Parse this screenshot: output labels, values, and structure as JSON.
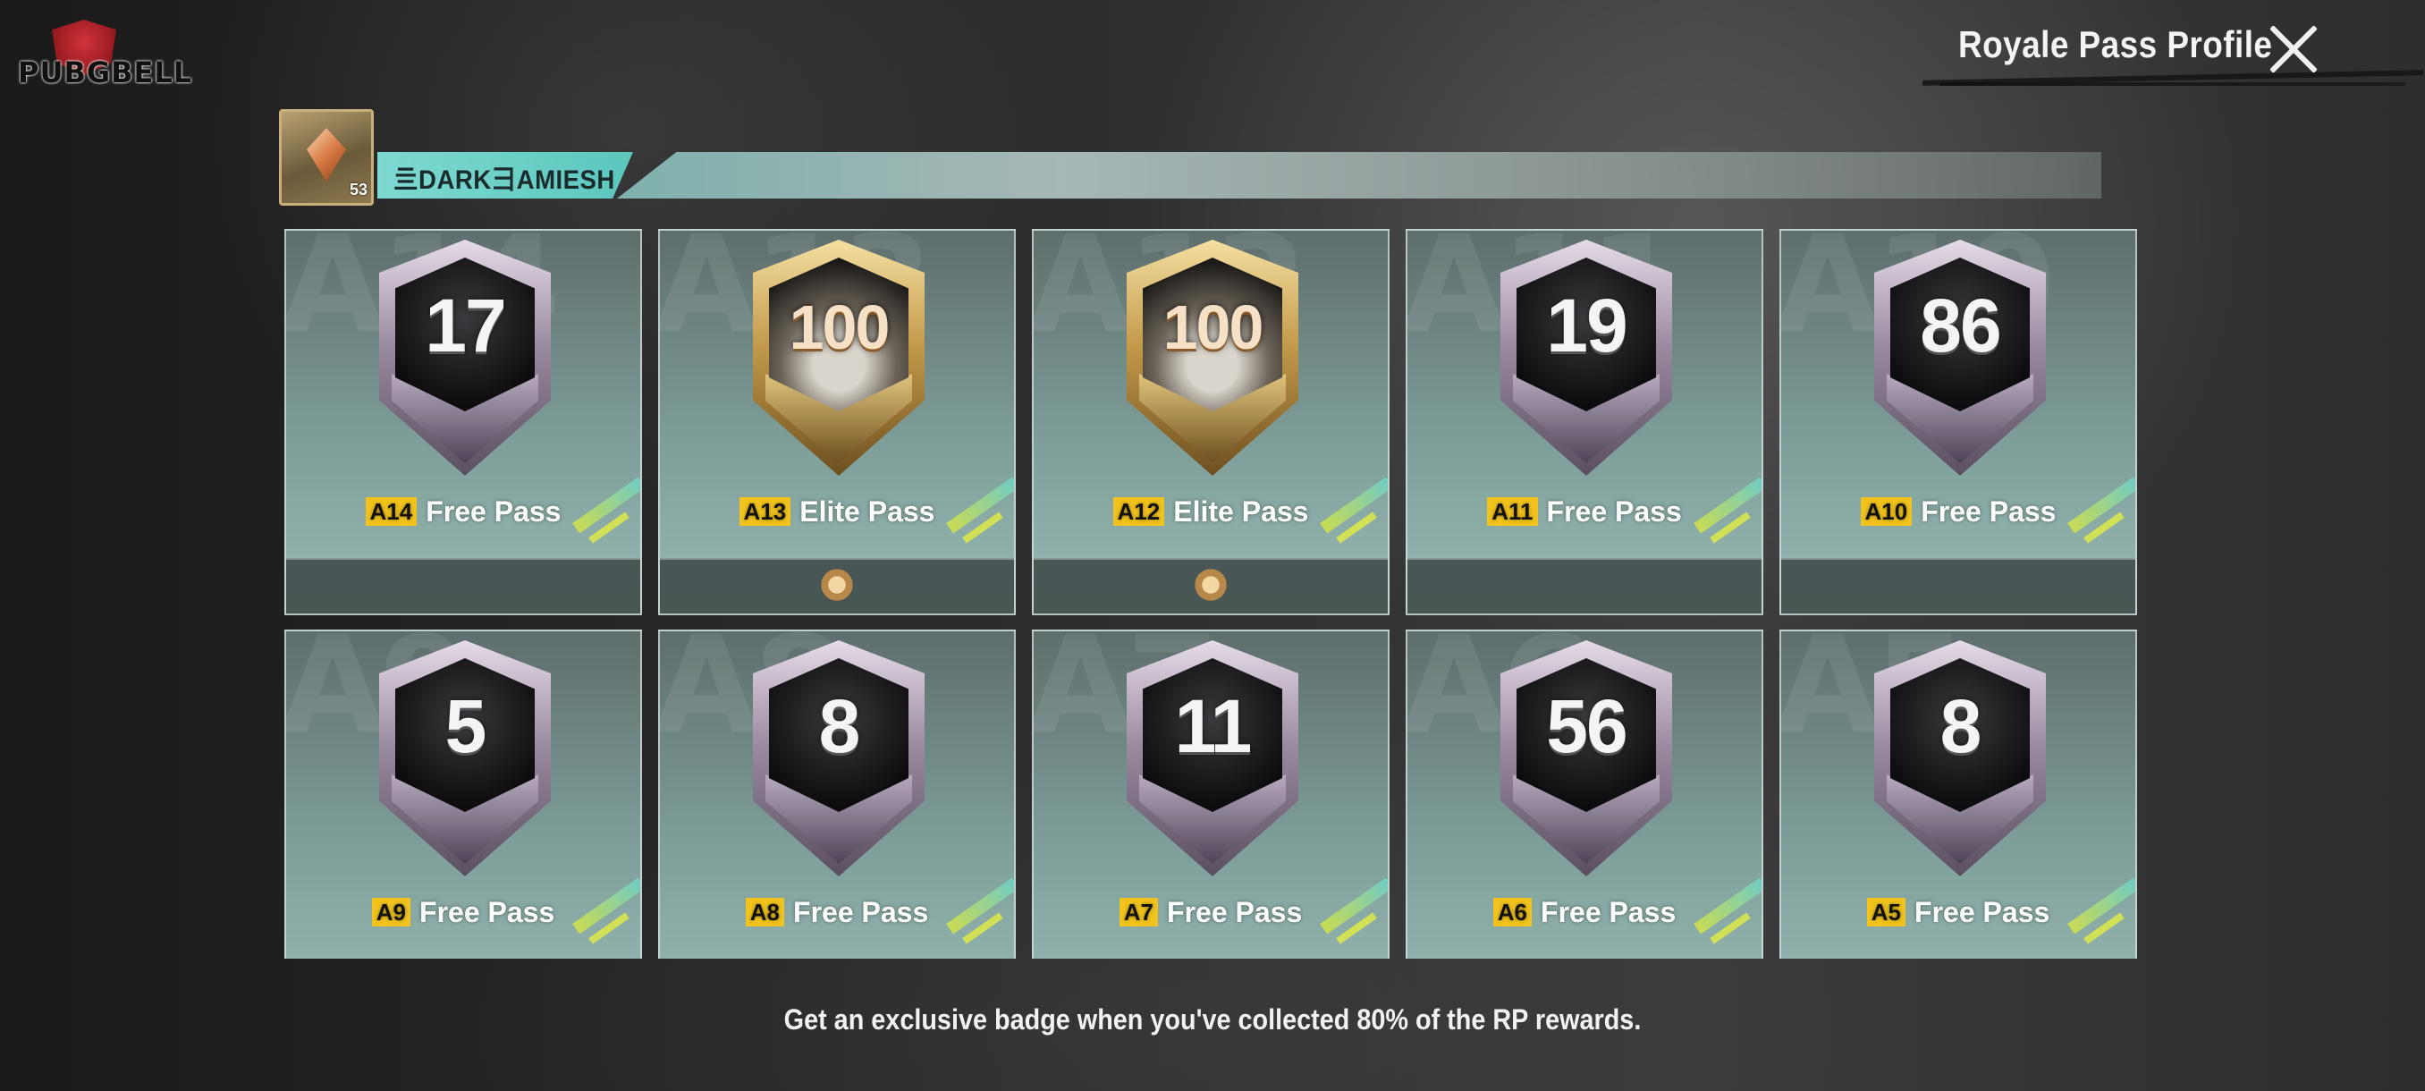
{
  "header": {
    "title": "Royale Pass Profile",
    "close_icon": "close-icon"
  },
  "watermark": {
    "brand": "PUBGBELL"
  },
  "player": {
    "name": "亖DARK⺕AMIESH",
    "level": "53",
    "avatar_icon": "diamond-tier-frame-icon"
  },
  "passes": [
    {
      "season": "A14",
      "rank": "17",
      "type": "Free Pass",
      "gold": false,
      "ghost": "A14",
      "has_footer_icon": false
    },
    {
      "season": "A13",
      "rank": "100",
      "type": "Elite Pass",
      "gold": true,
      "ghost": "A13",
      "has_footer_icon": true
    },
    {
      "season": "A12",
      "rank": "100",
      "type": "Elite Pass",
      "gold": true,
      "ghost": "A12",
      "has_footer_icon": true
    },
    {
      "season": "A11",
      "rank": "19",
      "type": "Free Pass",
      "gold": false,
      "ghost": "A11",
      "has_footer_icon": false
    },
    {
      "season": "A10",
      "rank": "86",
      "type": "Free Pass",
      "gold": false,
      "ghost": "A10",
      "has_footer_icon": false
    },
    {
      "season": "A9",
      "rank": "5",
      "type": "Free Pass",
      "gold": false,
      "ghost": "A9",
      "has_footer_icon": false
    },
    {
      "season": "A8",
      "rank": "8",
      "type": "Free Pass",
      "gold": false,
      "ghost": "A8",
      "has_footer_icon": false
    },
    {
      "season": "A7",
      "rank": "11",
      "type": "Free Pass",
      "gold": false,
      "ghost": "A7",
      "has_footer_icon": false
    },
    {
      "season": "A6",
      "rank": "56",
      "type": "Free Pass",
      "gold": false,
      "ghost": "A6",
      "has_footer_icon": false
    },
    {
      "season": "A5",
      "rank": "8",
      "type": "Free Pass",
      "gold": false,
      "ghost": "A5",
      "has_footer_icon": false
    }
  ],
  "footer": {
    "text": "Get an exclusive badge when you've collected 80% of the RP rewards."
  },
  "colors": {
    "accent_teal": "#7ed9d1",
    "season_tag": "#f1c31c",
    "card_bg": "#7e9e99"
  }
}
